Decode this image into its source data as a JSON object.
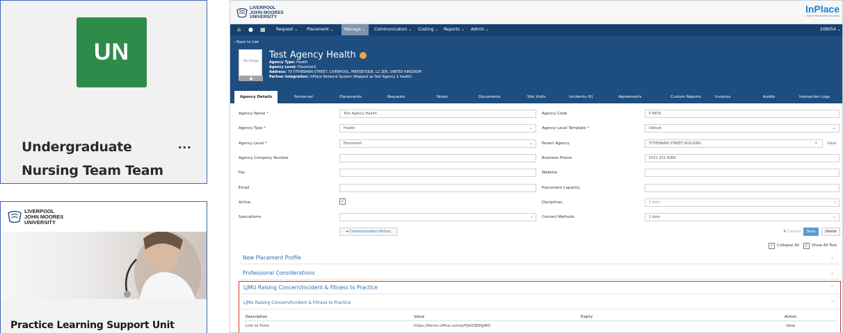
{
  "team_card": {
    "avatar_initials": "UN",
    "avatar_color": "#2e8b4a",
    "name_line1": "Undergraduate",
    "name_line2": "Nursing Team Team",
    "more_label": "..."
  },
  "plsu_card": {
    "logo_lines": [
      "LIVERPOOL",
      "JOHN MOORES",
      "UNIVERSITY"
    ],
    "title": "Practice Learning Support Unit"
  },
  "app": {
    "uni_logo_lines": [
      "LIVERPOOL",
      "JOHN MOORES",
      "UNIVERSITY"
    ],
    "brand": "InPlace",
    "brand_tagline": "Smart Placement Solutions",
    "nav": {
      "items": [
        "Request",
        "Placement",
        "Manage",
        "Communication",
        "Costing",
        "Reports",
        "Admin"
      ],
      "active": "Manage",
      "user": "208054"
    },
    "header": {
      "back": "Back to List",
      "photo_placeholder": "No Image",
      "title": "Test Agency Health",
      "type_label": "Agency Type:",
      "type_value": "Health",
      "level_label": "Agency Level:",
      "level_value": "Placement",
      "address_label": "Address:",
      "address_value": "79 TITHEBARN STREET, LIVERPOOL, MERSEYSIDE, L2 2ER, UNITED KINGDOM",
      "partner_label": "Partner Integration:",
      "partner_value": "InPlace Network System (Mapped as Test Agency 1 health)"
    },
    "tabs": [
      "Agency Details",
      "Personnel",
      "Placements",
      "Requests",
      "Notes",
      "Documents",
      "Site Visits",
      "Incidents (6)",
      "Agreements",
      "Custom Reports",
      "Invoices",
      "Audits",
      "Interaction Logs"
    ],
    "form": {
      "agency_name_label": "Agency Name",
      "agency_name_value": "Test Agency Health",
      "agency_type_label": "Agency Type",
      "agency_type_value": "Health",
      "agency_level_label": "Agency Level",
      "agency_level_value": "Placement",
      "company_number_label": "Agency Company Number",
      "fax_label": "Fax",
      "email_label": "Email",
      "active_label": "Active",
      "specialisms_label": "Specialisms",
      "agency_code_label": "Agency Code",
      "agency_code_value": "P-6876",
      "level_template_label": "Agency Level Template",
      "level_template_value": "Default",
      "parent_agency_label": "Parent Agency",
      "parent_agency_value": "TITHEBARN STREET BUILDING",
      "parent_view": "View",
      "business_phone_label": "Business Phone",
      "business_phone_value": "0151 231 4089",
      "website_label": "Website",
      "capacity_label": "Placement Capacity",
      "disciplines_label": "Disciplines",
      "disciplines_value": "1 Item",
      "contact_methods_label": "Contact Methods",
      "contact_methods_value": "1 Item",
      "comm_history": "Communication History",
      "cancel": "Cancel",
      "save": "Save",
      "delete": "Delete",
      "collapse_all": "Collapse All",
      "show_all": "Show All Test"
    },
    "sections": [
      "New Placement Profile",
      "Professional Considerations",
      "LJMU Raising Concern/Incident & Fitness to Practice"
    ],
    "concern": {
      "subheading": "LJMU Raising Concern/Incident & Fitness to Practice",
      "columns": [
        "Description",
        "Value",
        "Expiry",
        "Action"
      ],
      "row": {
        "description": "Link to Form",
        "value": "https://forms.office.com/e/fQkDSEPgWQ",
        "expiry": "",
        "action": "View"
      }
    },
    "colors": {
      "nav": "#16406e",
      "header": "#1e4d80",
      "accent": "#2b6fbf",
      "highlight_border": "#d32f2f"
    }
  }
}
